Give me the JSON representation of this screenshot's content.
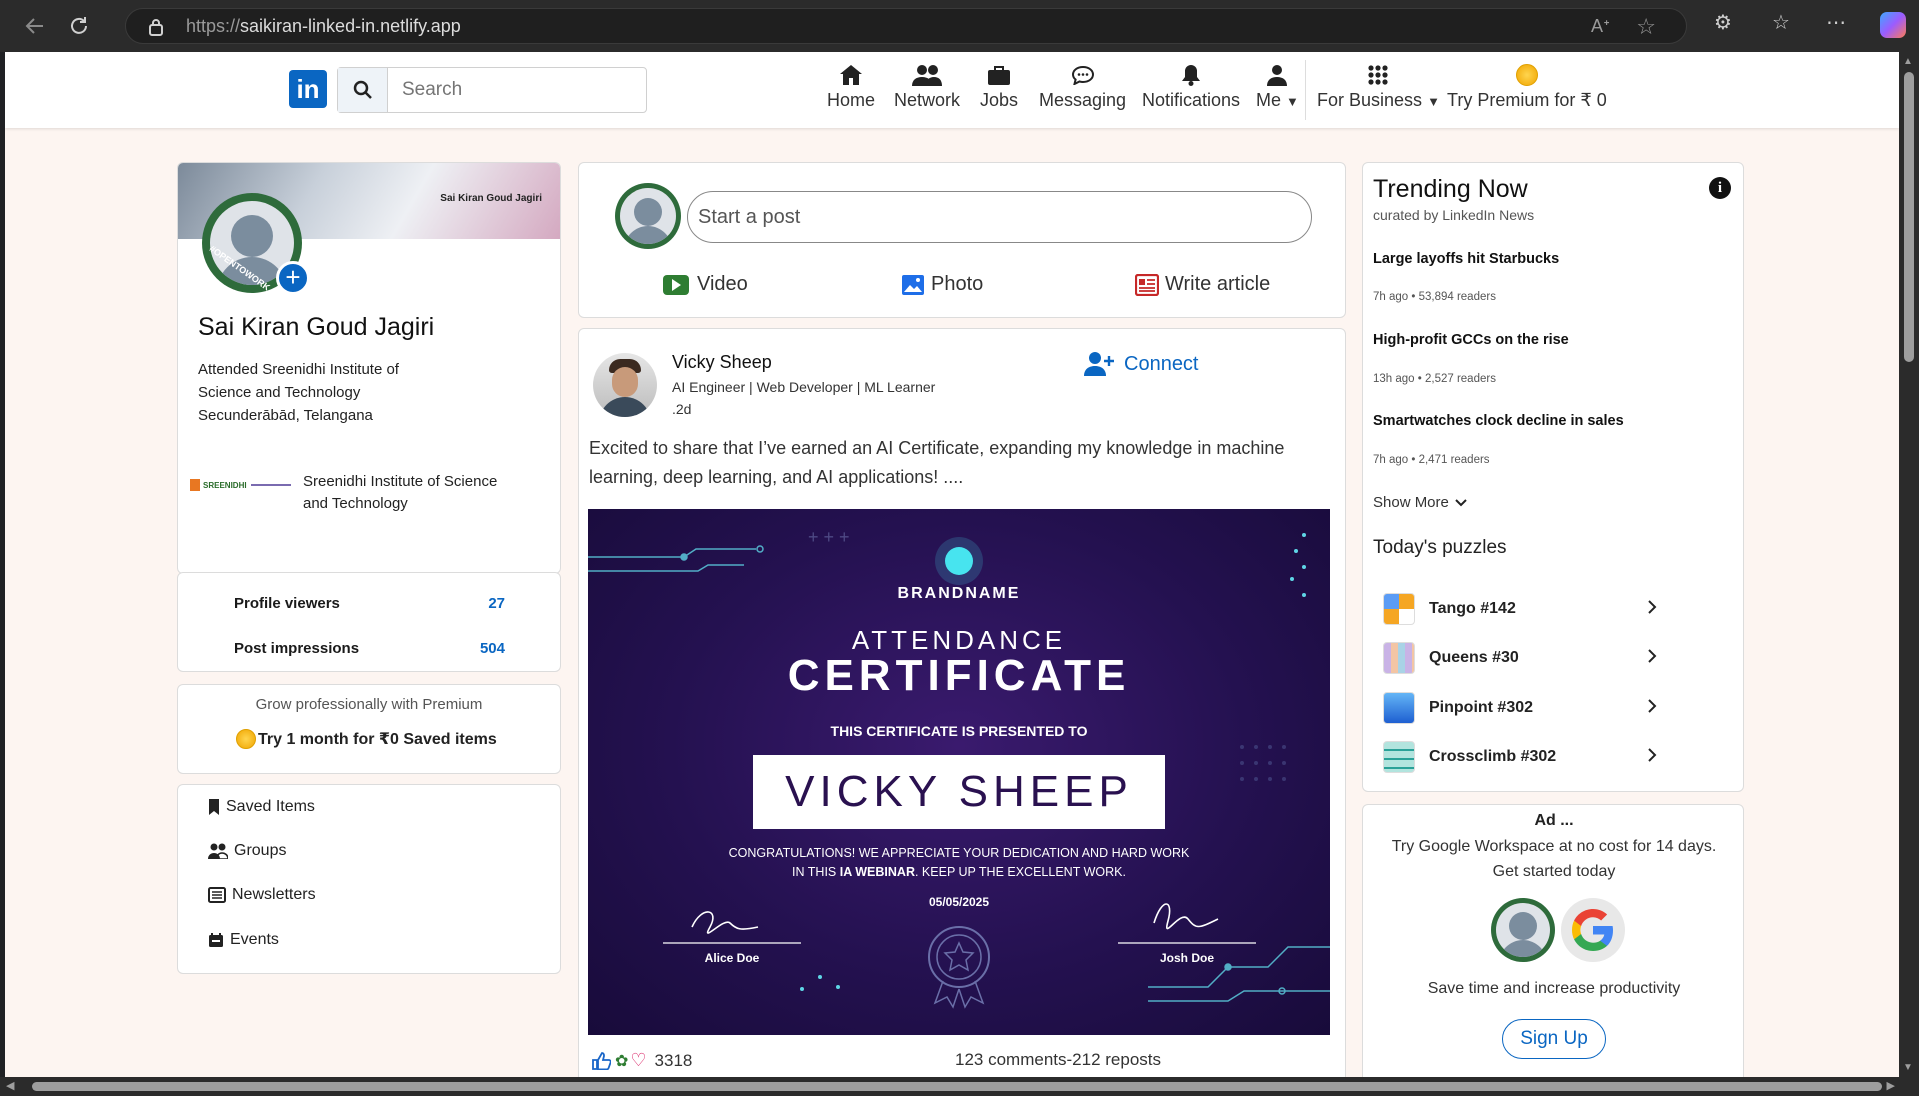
{
  "browser": {
    "url_protocol": "https://",
    "url_host": "saikiran-linked-in.netlify.app"
  },
  "nav": {
    "logo": "in",
    "search_placeholder": "Search",
    "items": [
      {
        "label": "Home",
        "icon": "home-icon"
      },
      {
        "label": "Network",
        "icon": "people-icon"
      },
      {
        "label": "Jobs",
        "icon": "briefcase-icon"
      },
      {
        "label": "Messaging",
        "icon": "message-icon"
      },
      {
        "label": "Notifications",
        "icon": "bell-icon"
      },
      {
        "label": "Me",
        "icon": "user-icon"
      }
    ],
    "business": "For Business",
    "premium": "Try Premium for ₹ 0"
  },
  "profile": {
    "banner_text": "Sai Kiran Goud Jagiri",
    "badge": "#OPENTOWORK",
    "name": "Sai Kiran Goud Jagiri",
    "education_line1": "Attended Sreenidhi Institute of",
    "education_line2": "Science and Technology",
    "location": "Secunderābād, Telangana",
    "institute_logo_text": "SREENIDHI",
    "institute_line1": "Sreenidhi Institute of Science",
    "institute_line2": "and Technology"
  },
  "stats": {
    "viewers_label": "Profile viewers",
    "viewers_value": "27",
    "impressions_label": "Post impressions",
    "impressions_value": "504"
  },
  "premium_card": {
    "tagline": "Grow professionally with Premium",
    "cta": "Try 1 month for ₹0 Saved items"
  },
  "left_links": [
    "Saved Items",
    "Groups",
    "Newsletters",
    "Events"
  ],
  "composer": {
    "placeholder": "Start a post",
    "video": "Video",
    "photo": "Photo",
    "article": "Write article"
  },
  "post": {
    "author": "Vicky Sheep",
    "headline": "AI Engineer | Web Developer | ML Learner",
    "time": ".2d",
    "connect": "Connect",
    "text": "Excited to share that I’ve earned an AI Certificate, expanding my knowledge in machine learning, deep learning, and AI applications! ....",
    "reactions": "3318",
    "comments_reposts": "123 comments-212 reposts",
    "certificate": {
      "brand": "BRANDNAME",
      "title1": "ATTENDANCE",
      "title2": "CERTIFICATE",
      "presented": "THIS CERTIFICATE IS PRESENTED TO",
      "recipient": "VICKY SHEEP",
      "message1": "CONGRATULATIONS! WE APPRECIATE YOUR DEDICATION AND HARD WORK",
      "message2_pre": "IN THIS ",
      "message2_bold": "IA WEBINAR",
      "message2_post": ". KEEP UP THE EXCELLENT WORK.",
      "date": "05/05/2025",
      "sig_left": "Alice Doe",
      "sig_right": "Josh Doe"
    }
  },
  "trending": {
    "title": "Trending Now",
    "subtitle": "curated by LinkedIn News",
    "items": [
      {
        "headline": "Large layoffs hit Starbucks",
        "meta": "7h ago • 53,894 readers"
      },
      {
        "headline": "High-profit GCCs on the rise",
        "meta": "13h ago • 2,527 readers"
      },
      {
        "headline": "Smartwatches clock decline in sales",
        "meta": "7h ago • 2,471 readers"
      }
    ],
    "show_more": "Show More",
    "puzzles_title": "Today's puzzles",
    "puzzles": [
      {
        "label": "Tango #142",
        "color": "#f5a623"
      },
      {
        "label": "Queens #30",
        "color": "#b39ddb"
      },
      {
        "label": "Pinpoint #302",
        "color": "#1e88e5"
      },
      {
        "label": "Crossclimb #302",
        "color": "#26a69a"
      }
    ]
  },
  "ad": {
    "label": "Ad ...",
    "line1": "Try Google Workspace at no cost for 14 days.",
    "line2": "Get started today",
    "tagline": "Save time and increase productivity",
    "cta": "Sign Up"
  },
  "colors": {
    "brand": "#0a66c2",
    "page_bg": "#fdf5f1",
    "certificate_bg": "#2a1150"
  }
}
